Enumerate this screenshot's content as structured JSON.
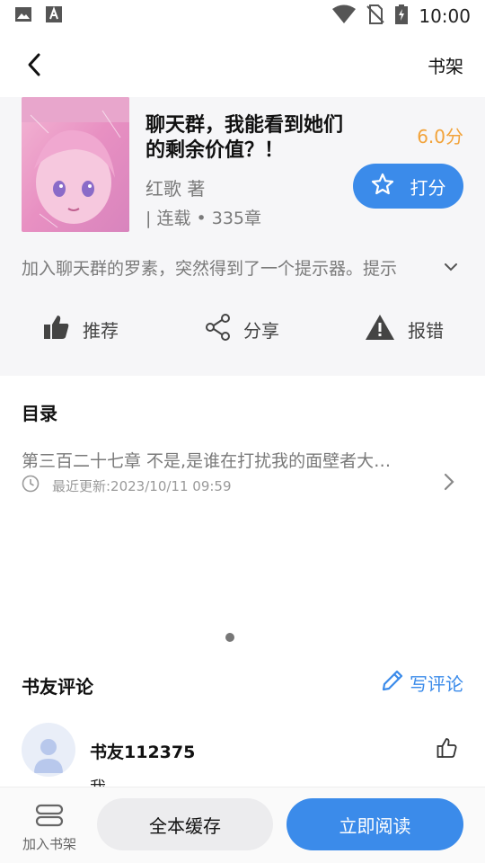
{
  "status": {
    "time": "10:00"
  },
  "nav": {
    "right_label": "书架"
  },
  "book": {
    "title": "聊天群，我能看到她们的剩余价值？！",
    "rating": "6.0分",
    "author": "红歌 著",
    "meta": "| 连载 • 335章",
    "rate_label": "打分",
    "intro": "加入聊天群的罗素，突然得到了一个提示器。提示"
  },
  "actions": [
    {
      "label": "推荐",
      "icon": "thumbs-up-icon"
    },
    {
      "label": "分享",
      "icon": "share-icon"
    },
    {
      "label": "报错",
      "icon": "warning-icon"
    }
  ],
  "toc": {
    "title": "目录",
    "latest_chapter": "第三百二十七章 不是,是谁在打扰我的面壁者大…",
    "updated": "最近更新:2023/10/11 09:59"
  },
  "reviews": {
    "title": "书友评论",
    "write_label": "写评论",
    "items": [
      {
        "user": "书友112375",
        "text": "我"
      }
    ]
  },
  "bottom": {
    "shelf_label": "加入书架",
    "cache_label": "全本缓存",
    "read_label": "立即阅读"
  },
  "colors": {
    "accent": "#3b8bea",
    "rating": "#f2a33a",
    "panel_bg": "#f6f6f8"
  }
}
